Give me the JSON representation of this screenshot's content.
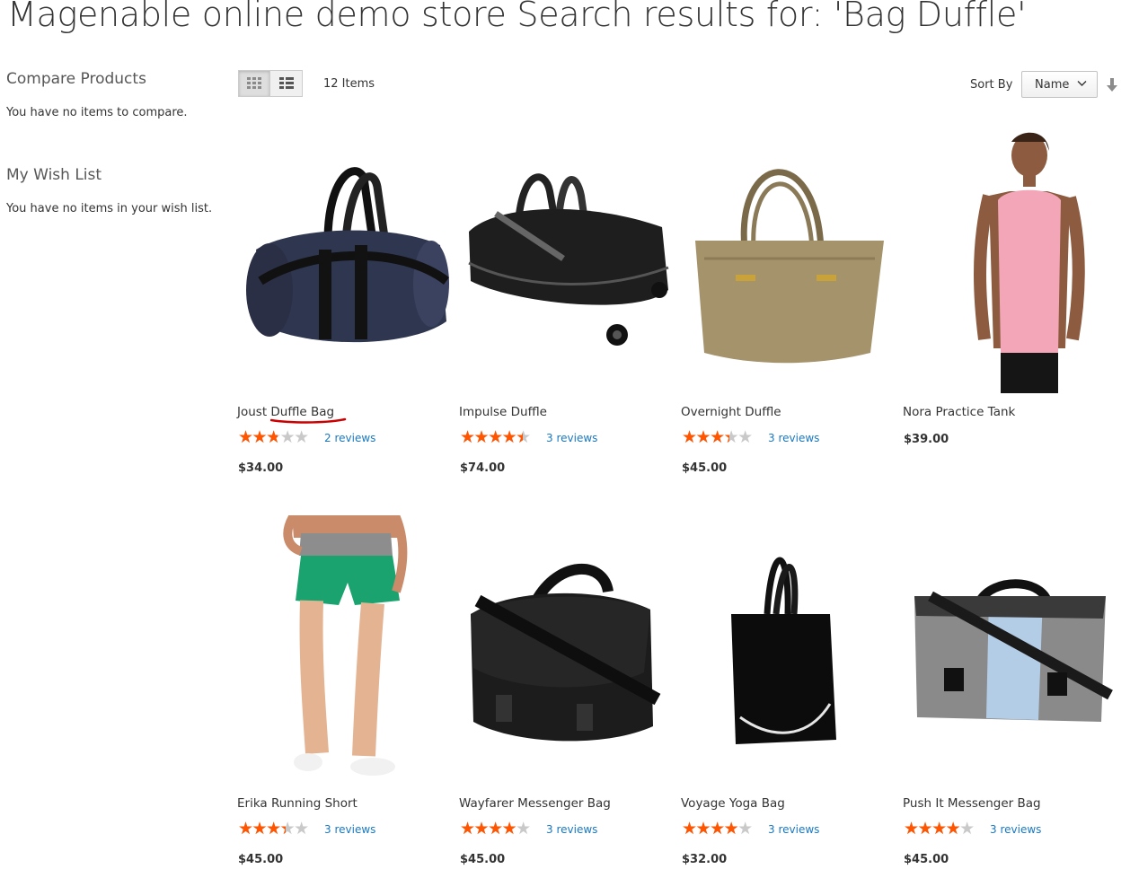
{
  "page": {
    "title": "Magenable online demo store Search results for: 'Bag Duffle'"
  },
  "sidebar": {
    "compare": {
      "title": "Compare Products",
      "text": "You have no items to compare."
    },
    "wishlist": {
      "title": "My Wish List",
      "text": "You have no items in your wish list."
    }
  },
  "toolbar": {
    "amount": "12 Items",
    "sort_label": "Sort By",
    "sort_value": "Name",
    "modes": [
      "grid-icon",
      "list-icon"
    ]
  },
  "colors": {
    "star": "#ff5501",
    "link": "#1979c3"
  },
  "products": [
    {
      "name": "Joust Duffle Bag",
      "rating": 0.5,
      "reviews": "2 reviews",
      "price": "$34.00"
    },
    {
      "name": "Impulse Duffle",
      "rating": 0.8,
      "reviews": "3 reviews",
      "price": "$74.00"
    },
    {
      "name": "Overnight Duffle",
      "rating": 0.6,
      "reviews": "3 reviews",
      "price": "$45.00"
    },
    {
      "name": "Nora Practice Tank",
      "price": "$39.00"
    },
    {
      "name": "Erika Running Short",
      "rating": 0.6,
      "reviews": "3 reviews",
      "price": "$45.00"
    },
    {
      "name": "Wayfarer Messenger Bag",
      "rating": 0.7,
      "reviews": "3 reviews",
      "price": "$45.00"
    },
    {
      "name": "Voyage Yoga Bag",
      "rating": 0.7,
      "reviews": "3 reviews",
      "price": "$32.00"
    },
    {
      "name": "Push It Messenger Bag",
      "rating": 0.7,
      "reviews": "3 reviews",
      "price": "$45.00"
    }
  ]
}
